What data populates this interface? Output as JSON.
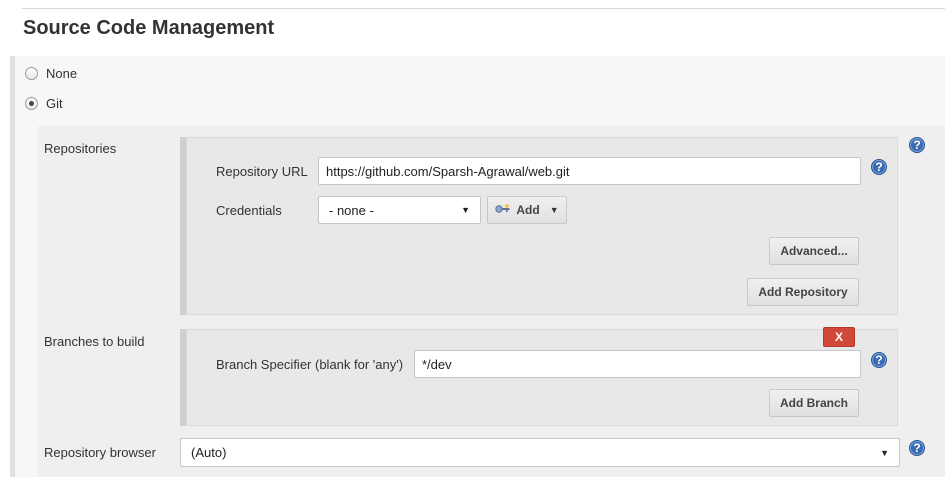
{
  "section": {
    "title": "Source Code Management"
  },
  "scm_options": [
    {
      "label": "None",
      "checked": false
    },
    {
      "label": "Git",
      "checked": true
    }
  ],
  "repositories": {
    "label": "Repositories",
    "url_label": "Repository URL",
    "url_value": "https://github.com/Sparsh-Agrawal/web.git",
    "credentials_label": "Credentials",
    "credentials_value": "- none -",
    "add_label": "Add",
    "advanced_label": "Advanced...",
    "add_repository_label": "Add Repository"
  },
  "branches": {
    "label": "Branches to build",
    "delete_label": "X",
    "specifier_label": "Branch Specifier (blank for 'any')",
    "specifier_value": "*/dev",
    "add_branch_label": "Add Branch"
  },
  "repository_browser": {
    "label": "Repository browser",
    "value": "(Auto)"
  },
  "help_glyph": "?",
  "colors": {
    "help": "#3a6bb4",
    "delete": "#d24939",
    "panel": "#efefef"
  }
}
